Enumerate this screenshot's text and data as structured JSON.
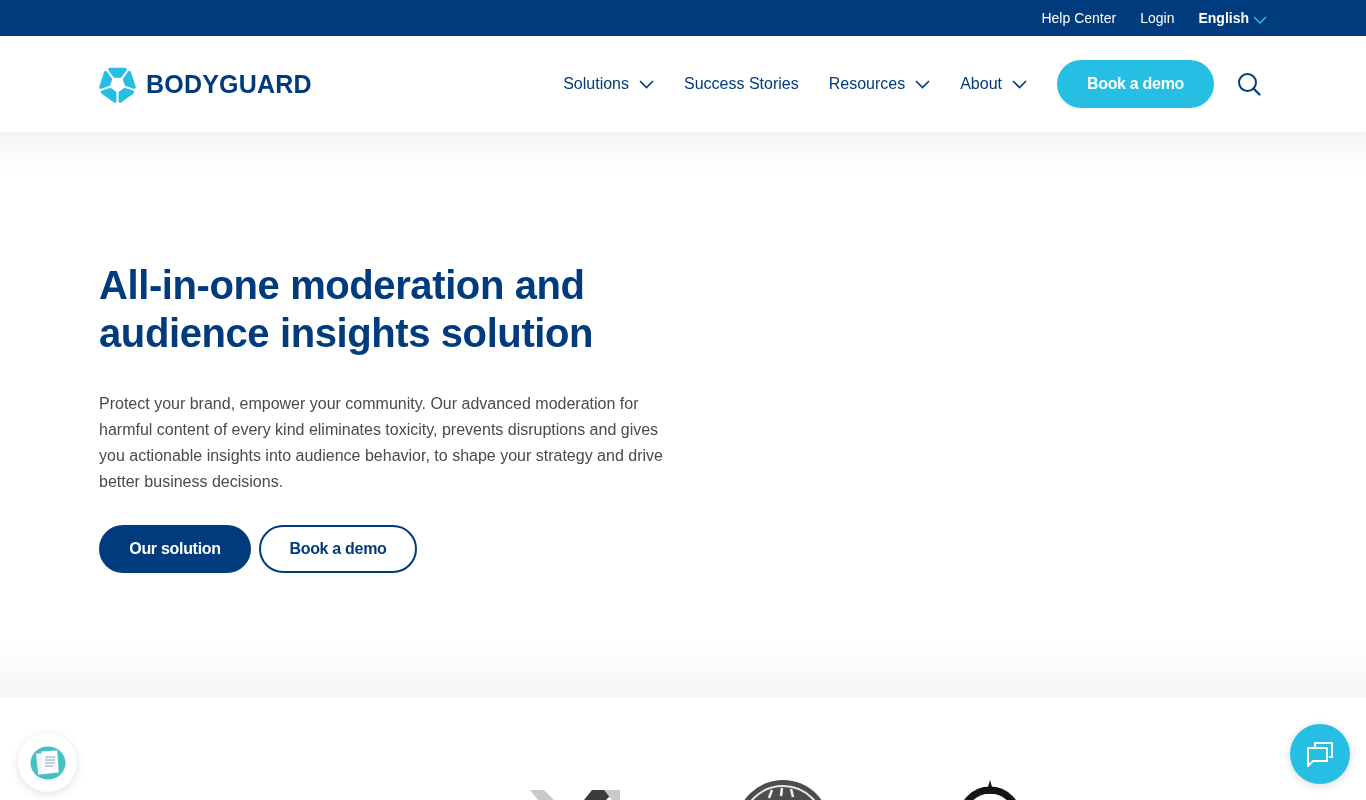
{
  "top_bar": {
    "links": [
      {
        "label": "Help Center"
      },
      {
        "label": "Login"
      }
    ],
    "language": {
      "label": "English",
      "has_dropdown": true
    }
  },
  "header": {
    "logo": {
      "text": "BODYGUARD"
    },
    "nav": [
      {
        "label": "Solutions",
        "has_dropdown": true
      },
      {
        "label": "Success Stories",
        "has_dropdown": false
      },
      {
        "label": "Resources",
        "has_dropdown": true
      },
      {
        "label": "About",
        "has_dropdown": true
      }
    ],
    "cta": {
      "label": "Book a demo"
    }
  },
  "hero": {
    "title": "All-in-one moderation and audience insights solution",
    "text": "Protect your brand, empower your community. Our advanced moderation for harmful content of every kind eliminates toxicity, prevents disruptions and gives you actionable insights into audience behavior, to shape your strategy and drive better business decisions.",
    "buttons": [
      {
        "label": "Our solution",
        "kind": "primary"
      },
      {
        "label": "Book a demo",
        "kind": "outline"
      }
    ]
  }
}
